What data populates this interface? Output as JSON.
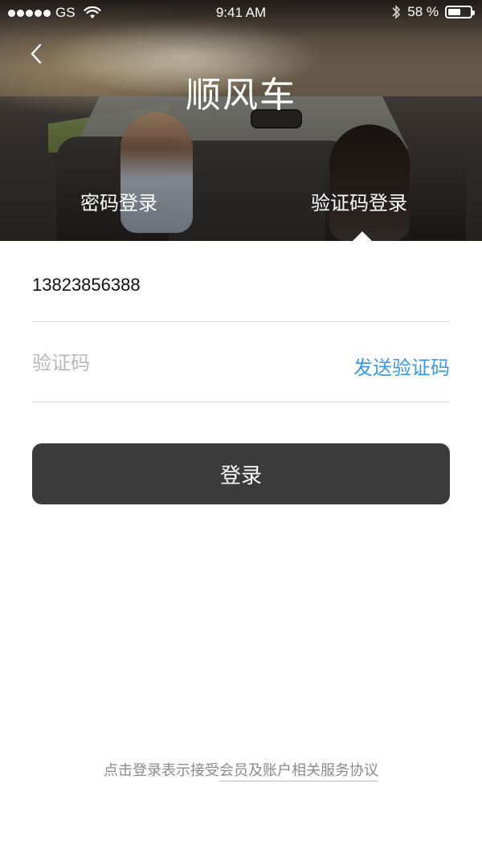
{
  "status_bar": {
    "carrier": "GS",
    "time": "9:41 AM",
    "battery_percent_label": "58 %",
    "battery_level": 0.58,
    "icons": [
      "signal-dots-icon",
      "wifi-icon",
      "bluetooth-icon",
      "battery-icon"
    ]
  },
  "header": {
    "title": "顺风车",
    "back_icon": "chevron-left-icon"
  },
  "tabs": [
    {
      "label": "密码登录",
      "selected": false
    },
    {
      "label": "验证码登录",
      "selected": true
    }
  ],
  "form": {
    "phone_value": "13823856388",
    "code_placeholder": "验证码",
    "code_value": "",
    "send_code_label": "发送验证码",
    "submit_label": "登录"
  },
  "footer": {
    "agreement_prefix": "点击登录表示接受",
    "agreement_link": "会员及账户相关服务协议"
  },
  "colors": {
    "accent": "#3a9ae6",
    "button_bg": "#3b3b3b",
    "placeholder": "#b8b8b8",
    "divider": "#d9d9d9"
  }
}
